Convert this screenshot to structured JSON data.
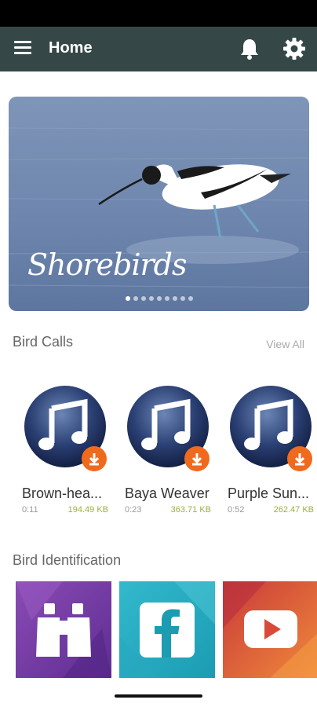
{
  "app_bar": {
    "title": "Home",
    "menu_icon": "hamburger-menu-icon",
    "notification_icon": "bell-icon",
    "settings_icon": "gear-icon",
    "background": "#364747"
  },
  "banner": {
    "caption": "Shorebirds",
    "slide_count": 9,
    "active_slide": 1
  },
  "bird_calls": {
    "title": "Bird Calls",
    "view_all_label": "View All",
    "items": [
      {
        "name": "Brown-hea...",
        "duration": "0:11",
        "size": "194.49 KB",
        "icon": "music-note-icon"
      },
      {
        "name": "Baya Weaver",
        "duration": "0:23",
        "size": "363.71 KB",
        "icon": "music-note-icon"
      },
      {
        "name": "Purple Sun...",
        "duration": "0:52",
        "size": "262.47 KB",
        "icon": "music-note-icon"
      }
    ],
    "accent_color": "#f06a1e"
  },
  "bird_identification": {
    "title": "Bird Identification",
    "tiles": [
      {
        "icon": "binoculars-icon",
        "color": "#7b3fa8"
      },
      {
        "icon": "facebook-icon",
        "color": "#2ab0c6"
      },
      {
        "icon": "youtube-icon",
        "color": "#e0483a"
      }
    ]
  }
}
